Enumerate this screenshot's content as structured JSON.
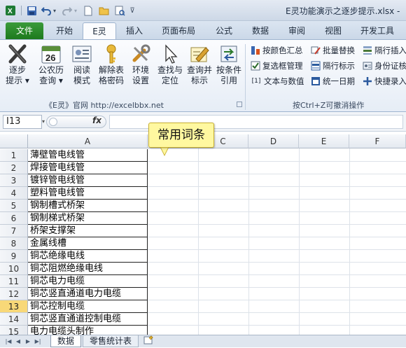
{
  "window": {
    "title": "E灵功能演示之逐步提示.xlsx -"
  },
  "tabs": [
    {
      "label": "文件"
    },
    {
      "label": "开始"
    },
    {
      "label": "E灵"
    },
    {
      "label": "插入"
    },
    {
      "label": "页面布局"
    },
    {
      "label": "公式"
    },
    {
      "label": "数据"
    },
    {
      "label": "审阅"
    },
    {
      "label": "视图"
    },
    {
      "label": "开发工具"
    }
  ],
  "ribbon": {
    "buttons": [
      {
        "line1": "逐步",
        "line2": "提示 ▾",
        "icon": "x-cross-icon"
      },
      {
        "line1": "公农历",
        "line2": "查询 ▾",
        "icon": "calendar-icon",
        "badge": "26"
      },
      {
        "line1": "阅读",
        "line2": "模式",
        "icon": "reader-card-icon"
      },
      {
        "line1": "解除表",
        "line2": "格密码",
        "icon": "key-icon"
      },
      {
        "line1": "环境",
        "line2": "设置",
        "icon": "tools-icon"
      },
      {
        "line1": "查找与",
        "line2": "定位",
        "icon": "cursor-icon"
      },
      {
        "line1": "查询并",
        "line2": "标示",
        "icon": "highlight-pen-icon"
      },
      {
        "line1": "按条件",
        "line2": "引用",
        "icon": "arrows-reference-icon"
      }
    ],
    "group1_label": "《E灵》官网   http://excelbbx.net",
    "group2_label": "按Ctrl+Z可撤消操作",
    "small_buttons": [
      {
        "label": "按颜色汇总",
        "icon": "color-sum-icon"
      },
      {
        "label": "批量替换",
        "icon": "batch-replace-icon"
      },
      {
        "label": "隔行插入",
        "icon": "row-insert-icon"
      },
      {
        "label": "复选框管理",
        "icon": "checkbox-icon"
      },
      {
        "label": "隔行标示",
        "icon": "row-mark-icon"
      },
      {
        "label": "身份证核",
        "icon": "id-card-icon"
      },
      {
        "label": "文本与数值",
        "icon": "text-number-icon"
      },
      {
        "label": "统一日期",
        "icon": "date-icon"
      },
      {
        "label": "快捷录入",
        "icon": "quick-entry-icon"
      }
    ]
  },
  "formula_bar": {
    "name_box": "I13",
    "fx": "fx",
    "value": ""
  },
  "grid": {
    "col_headers": [
      "A",
      "C",
      "D",
      "E",
      "F"
    ],
    "rows": [
      {
        "num": "1",
        "a": "薄壁管电线管"
      },
      {
        "num": "2",
        "a": "焊接管电线管"
      },
      {
        "num": "3",
        "a": "镀锌管电线管"
      },
      {
        "num": "4",
        "a": "塑料管电线管"
      },
      {
        "num": "5",
        "a": "钢制槽式桥架"
      },
      {
        "num": "6",
        "a": "钢制梯式桥架"
      },
      {
        "num": "7",
        "a": "桥架支撑架"
      },
      {
        "num": "8",
        "a": "金属线槽"
      },
      {
        "num": "9",
        "a": "铜芯绝缘电线"
      },
      {
        "num": "10",
        "a": "铜芯阻燃绝缘电线"
      },
      {
        "num": "11",
        "a": "铜芯电力电缆"
      },
      {
        "num": "12",
        "a": "铜芯竖直通道电力电缆"
      },
      {
        "num": "13",
        "a": "铜芯控制电缆"
      },
      {
        "num": "14",
        "a": "铜芯竖直通道控制电缆"
      },
      {
        "num": "15",
        "a": "电力电缆头制作"
      }
    ],
    "callout": "常用词条"
  },
  "sheets": [
    {
      "label": "数据"
    },
    {
      "label": "零售统计表"
    }
  ]
}
